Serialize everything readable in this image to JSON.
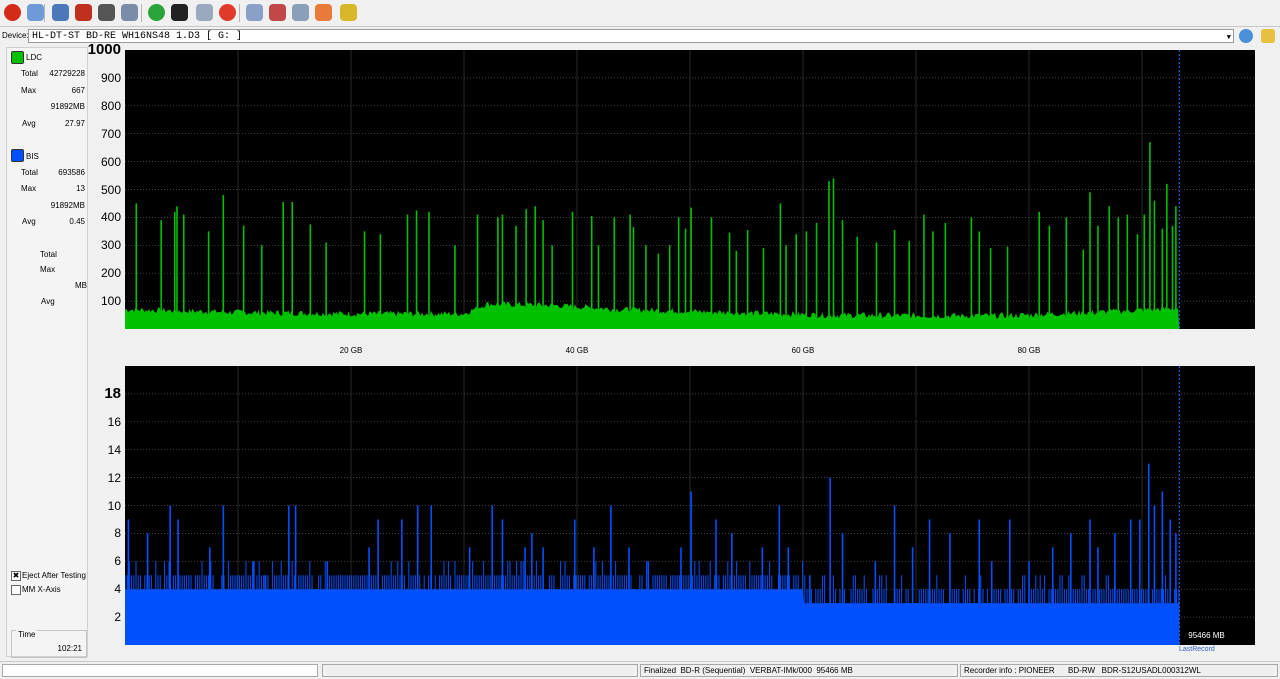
{
  "toolbar": {
    "buttons": [
      {
        "icon": "power-icon",
        "color": "#d42a1a"
      },
      {
        "icon": "wrench-icon",
        "color": "#6e9ad8"
      },
      {
        "icon": "monitor-icon",
        "color": "#4a78b8"
      },
      {
        "icon": "erase-icon",
        "color": "#c0301f"
      },
      {
        "icon": "disc-drive-icon",
        "color": "#555555"
      },
      {
        "icon": "copy-icon",
        "color": "#7a8ca8"
      },
      {
        "icon": "refresh-icon",
        "color": "#2aa43a"
      },
      {
        "icon": "record-icon",
        "color": "#222222"
      },
      {
        "icon": "disc-add-icon",
        "color": "#9aa8c0"
      },
      {
        "icon": "stop-icon",
        "color": "#e03a2a"
      },
      {
        "icon": "disc-info-icon",
        "color": "#8aa0c8"
      },
      {
        "icon": "eject-icon",
        "color": "#c04848"
      },
      {
        "icon": "save-icon",
        "color": "#8aa0b8"
      },
      {
        "icon": "palette-icon",
        "color": "#e87a3a"
      },
      {
        "icon": "chart-icon",
        "color": "#d8b82a"
      }
    ]
  },
  "device": {
    "label": "Device:",
    "value": "HL-DT-ST BD-RE  WH16NS48  1.D3 [ G: ]"
  },
  "legend": {
    "ldc": {
      "name": "LDC",
      "color": "#00c000",
      "total_label": "Total",
      "total": "42729228",
      "max_label": "Max",
      "max": "667",
      "mb": "91892MB",
      "avg_label": "Avg",
      "avg": "27.97"
    },
    "bis": {
      "name": "BIS",
      "color": "#0050ff",
      "total_label": "Total",
      "total": "693586",
      "max_label": "Max",
      "max": "13",
      "mb": "91892MB",
      "avg_label": "Avg",
      "avg": "0.45"
    },
    "third": {
      "total_label": "Total",
      "max_label": "Max",
      "mb_label": "MB",
      "avg_label": "Avg"
    }
  },
  "options": {
    "eject_label": "Eject After Testing",
    "eject_checked": true,
    "mm_label": "MM X-Axis",
    "mm_checked": false
  },
  "time": {
    "label": "Time",
    "value": "102:21"
  },
  "chart_data": [
    {
      "type": "line",
      "series": [
        {
          "name": "LDC",
          "color": "#00c000"
        }
      ],
      "ylim": [
        0,
        1000
      ],
      "yticks": [
        100,
        200,
        300,
        400,
        500,
        600,
        700,
        800,
        900
      ],
      "ytick_labels": [
        "100",
        "200",
        "300",
        "400",
        "500",
        "600",
        "700",
        "800",
        "900",
        "1000"
      ],
      "xlim": [
        0,
        100
      ],
      "xticks": [
        20,
        40,
        60,
        80
      ],
      "xtick_labels": [
        "20 GB",
        "40 GB",
        "60 GB",
        "80 GB"
      ],
      "data_end_gb": 93.3,
      "baseline": [
        [
          0,
          70
        ],
        [
          10,
          60
        ],
        [
          20,
          55
        ],
        [
          30,
          55
        ],
        [
          32,
          90
        ],
        [
          38,
          85
        ],
        [
          44,
          70
        ],
        [
          55,
          58
        ],
        [
          62,
          50
        ],
        [
          70,
          48
        ],
        [
          78,
          48
        ],
        [
          86,
          60
        ],
        [
          93.3,
          75
        ]
      ],
      "peaks": [
        [
          1,
          450
        ],
        [
          3.2,
          390
        ],
        [
          4.4,
          420
        ],
        [
          4.6,
          440
        ],
        [
          5.2,
          410
        ],
        [
          7.4,
          350
        ],
        [
          8.7,
          480
        ],
        [
          10.5,
          370
        ],
        [
          12.1,
          300
        ],
        [
          14,
          455
        ],
        [
          14.8,
          455
        ],
        [
          16.4,
          375
        ],
        [
          17.8,
          310
        ],
        [
          21.2,
          350
        ],
        [
          22.6,
          340
        ],
        [
          25,
          410
        ],
        [
          25.8,
          425
        ],
        [
          26.9,
          420
        ],
        [
          29.2,
          300
        ],
        [
          31.2,
          410
        ],
        [
          33,
          400
        ],
        [
          33.4,
          410
        ],
        [
          34.6,
          370
        ],
        [
          35.5,
          430
        ],
        [
          36.3,
          440
        ],
        [
          37,
          390
        ],
        [
          37.8,
          300
        ],
        [
          39.6,
          420
        ],
        [
          41.3,
          405
        ],
        [
          41.9,
          300
        ],
        [
          43.3,
          400
        ],
        [
          44.7,
          410
        ],
        [
          45,
          365
        ],
        [
          46.1,
          300
        ],
        [
          47.2,
          270
        ],
        [
          48.2,
          300
        ],
        [
          49,
          400
        ],
        [
          49.6,
          360
        ],
        [
          50.1,
          435
        ],
        [
          51.9,
          400
        ],
        [
          53.5,
          345
        ],
        [
          54.1,
          280
        ],
        [
          55.1,
          355
        ],
        [
          56.5,
          290
        ],
        [
          58,
          450
        ],
        [
          58.5,
          300
        ],
        [
          59.4,
          340
        ],
        [
          60.3,
          350
        ],
        [
          61.2,
          380
        ],
        [
          62.3,
          530
        ],
        [
          62.7,
          540
        ],
        [
          63.5,
          390
        ],
        [
          64.8,
          330
        ],
        [
          66.5,
          310
        ],
        [
          68.1,
          355
        ],
        [
          69.4,
          315
        ],
        [
          70.7,
          410
        ],
        [
          71.5,
          350
        ],
        [
          72.6,
          380
        ],
        [
          74.9,
          400
        ],
        [
          75.6,
          350
        ],
        [
          76.6,
          290
        ],
        [
          78.1,
          295
        ],
        [
          80.9,
          420
        ],
        [
          81.8,
          370
        ],
        [
          83.3,
          400
        ],
        [
          84.8,
          285
        ],
        [
          85.4,
          490
        ],
        [
          86.1,
          370
        ],
        [
          87.1,
          440
        ],
        [
          87.9,
          400
        ],
        [
          88.7,
          410
        ],
        [
          89.6,
          340
        ],
        [
          90.2,
          410
        ],
        [
          90.7,
          670
        ],
        [
          91.1,
          460
        ],
        [
          91.8,
          360
        ],
        [
          92.2,
          520
        ],
        [
          92.7,
          370
        ],
        [
          93,
          440
        ]
      ]
    },
    {
      "type": "bar",
      "series": [
        {
          "name": "BIS",
          "color": "#0050ff"
        }
      ],
      "ylim": [
        0,
        20
      ],
      "yticks": [
        2,
        4,
        6,
        8,
        10,
        12,
        14,
        16,
        18
      ],
      "ytick_labels": [
        "2",
        "4",
        "6",
        "8",
        "10",
        "12",
        "14",
        "16",
        "18"
      ],
      "xlim": [
        0,
        100
      ],
      "xticks": [
        20,
        40,
        60,
        80
      ],
      "xtick_labels": [
        "20 GB",
        "40 GB",
        "60 GB",
        "80 GB"
      ],
      "data_end_gb": 93.3,
      "baseline": [
        [
          0,
          4
        ],
        [
          60,
          4
        ],
        [
          60.1,
          3
        ],
        [
          80,
          3
        ],
        [
          93.3,
          3
        ]
      ],
      "peaks": [
        [
          0.3,
          9
        ],
        [
          2,
          8
        ],
        [
          4,
          10
        ],
        [
          4.7,
          9
        ],
        [
          7.5,
          7
        ],
        [
          8.7,
          10
        ],
        [
          11.4,
          6
        ],
        [
          12.4,
          5
        ],
        [
          14.5,
          10
        ],
        [
          15.1,
          10
        ],
        [
          17.9,
          6
        ],
        [
          21.6,
          7
        ],
        [
          22.4,
          9
        ],
        [
          24.5,
          9
        ],
        [
          25.9,
          10
        ],
        [
          27.1,
          10
        ],
        [
          30.5,
          7
        ],
        [
          32.5,
          10
        ],
        [
          33.4,
          9
        ],
        [
          35.4,
          7
        ],
        [
          36,
          8
        ],
        [
          37,
          7
        ],
        [
          39.8,
          9
        ],
        [
          41.5,
          7
        ],
        [
          43,
          10
        ],
        [
          44.6,
          7
        ],
        [
          46.3,
          6
        ],
        [
          49.2,
          7
        ],
        [
          50.1,
          11
        ],
        [
          52.3,
          9
        ],
        [
          53.7,
          8
        ],
        [
          56.4,
          7
        ],
        [
          57.9,
          10
        ],
        [
          58.7,
          7
        ],
        [
          60.6,
          5
        ],
        [
          62.4,
          12
        ],
        [
          63.5,
          8
        ],
        [
          66.4,
          6
        ],
        [
          68.1,
          10
        ],
        [
          69.7,
          7
        ],
        [
          71.2,
          9
        ],
        [
          73,
          8
        ],
        [
          75.6,
          9
        ],
        [
          76.7,
          6
        ],
        [
          78.3,
          9
        ],
        [
          80,
          6
        ],
        [
          82.1,
          7
        ],
        [
          83.7,
          8
        ],
        [
          85.4,
          9
        ],
        [
          86.1,
          7
        ],
        [
          87.6,
          8
        ],
        [
          89,
          9
        ],
        [
          89.8,
          9
        ],
        [
          90.6,
          13
        ],
        [
          91.1,
          10
        ],
        [
          91.8,
          11
        ],
        [
          92.5,
          9
        ],
        [
          93,
          8
        ]
      ],
      "end_label": "95466 MB",
      "last_record_label": "LastRecord"
    }
  ],
  "status": {
    "disc_info": "Finalized  BD-R (Sequential)  VERBAT-IMk/000  95466 MB",
    "recorder_info": "Recorder info : PIONEER      BD-RW   BDR-S12USADL000312WL"
  }
}
